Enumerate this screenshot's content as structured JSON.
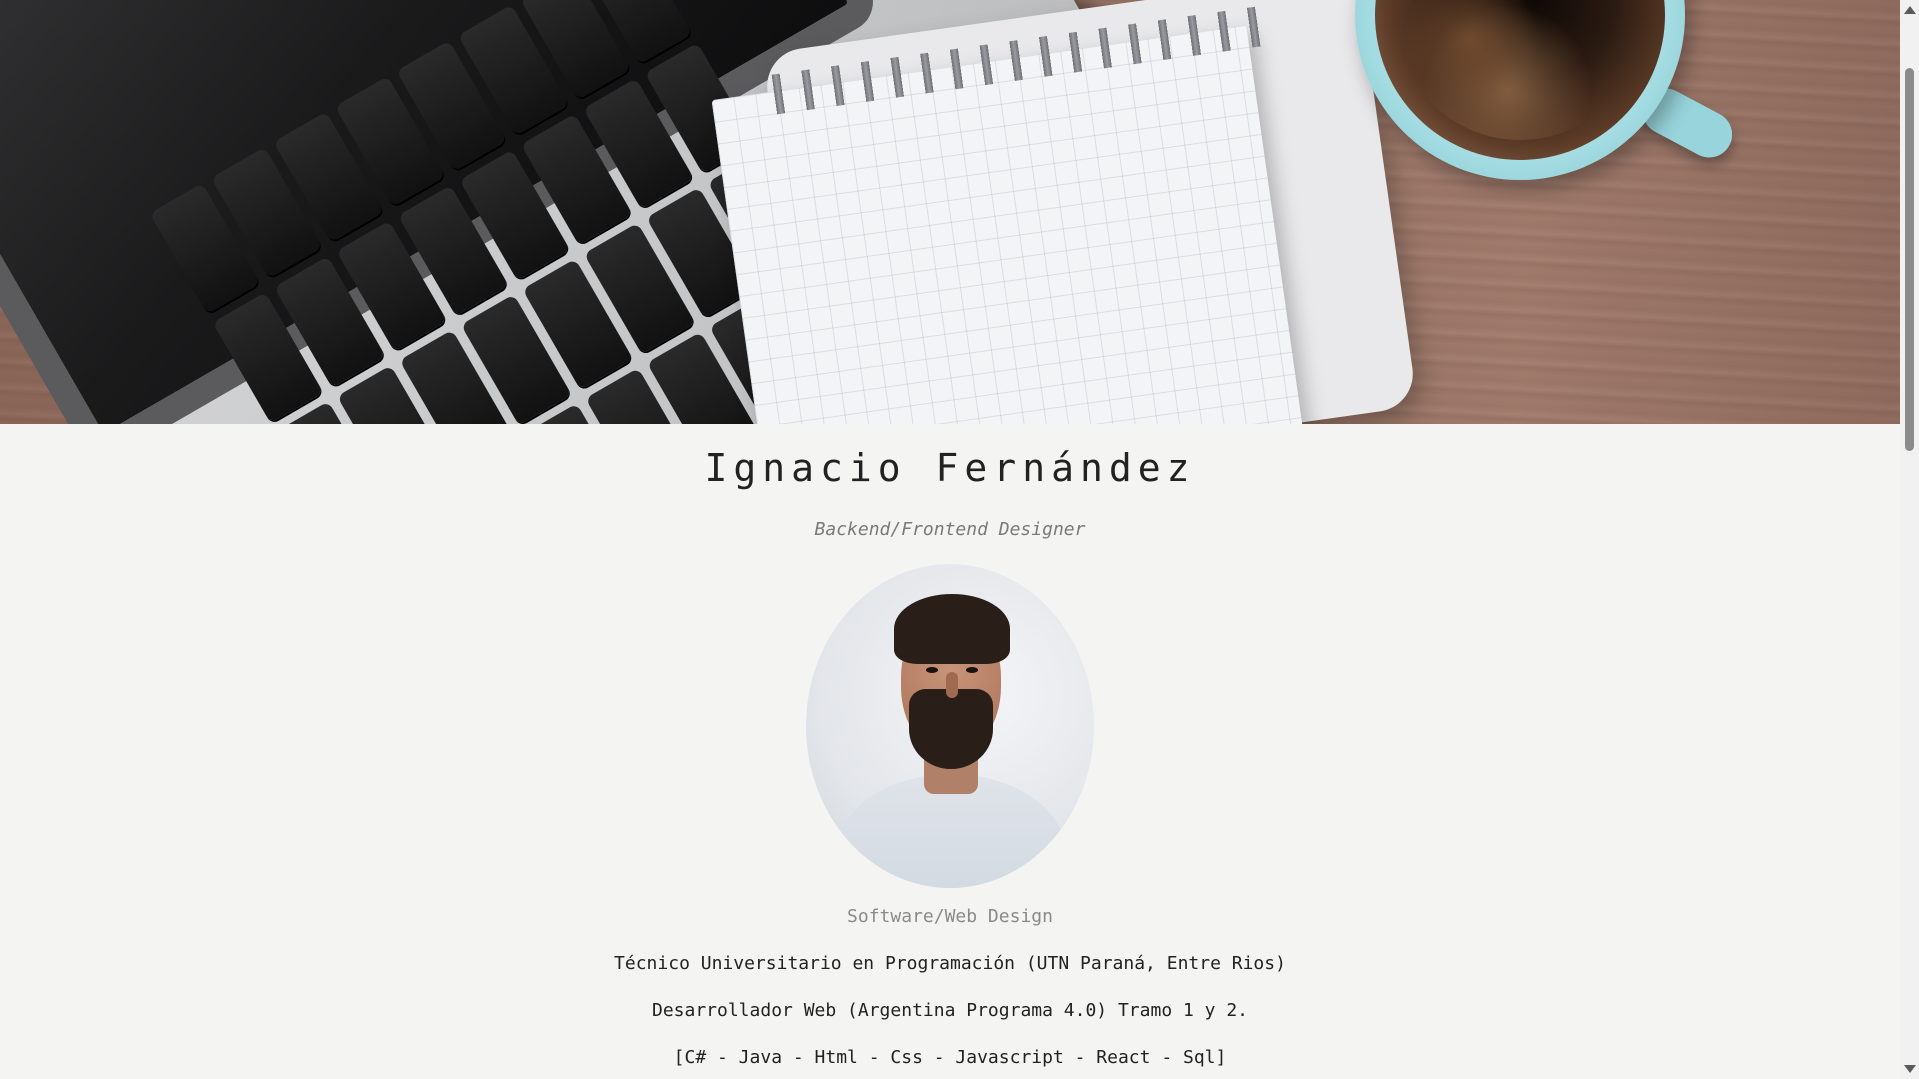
{
  "profile": {
    "name": "Ignacio Fernández",
    "role": "Backend/Frontend Designer",
    "avatar_alt": "Profile photo",
    "subtitle": "Software/Web Design",
    "lines": [
      "Técnico Universitario en Programación (UTN Paraná, Entre Rios)",
      "Desarrollador Web (Argentina Programa 4.0) Tramo 1 y 2.",
      "[C# - Java - Html - Css - Javascript - React - Sql]"
    ]
  },
  "hero": {
    "image_description": "desk with laptop, notebook and coffee cup"
  },
  "colors": {
    "background": "#f4f4f2",
    "text": "#222222",
    "muted": "#7a7a7a"
  }
}
